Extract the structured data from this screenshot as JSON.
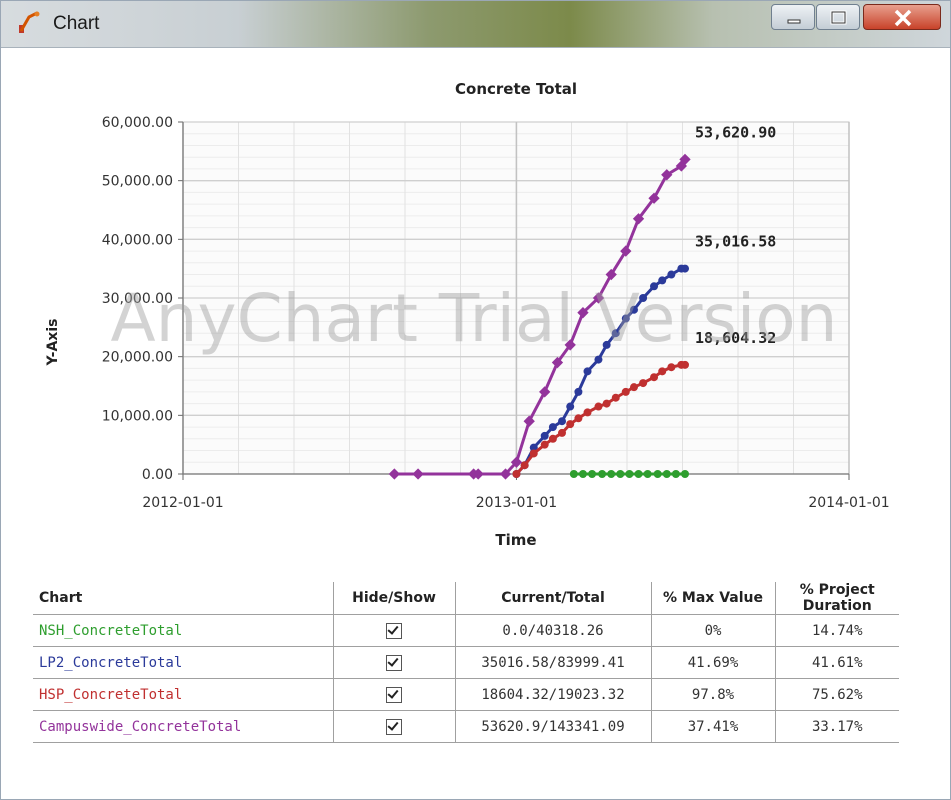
{
  "window": {
    "title": "Chart",
    "min_icon": "minimize-icon",
    "max_icon": "maximize-icon",
    "close_icon": "close-icon"
  },
  "watermark": "AnyChart Trial Version",
  "chart_data": {
    "type": "line",
    "title": "Concrete Total",
    "xlabel": "Time",
    "ylabel": "Y-Axis",
    "xlim": [
      "2012-01-01",
      "2014-01-01"
    ],
    "ylim": [
      0,
      60000
    ],
    "x_ticks": [
      "2012-01-01",
      "2013-01-01",
      "2014-01-01"
    ],
    "y_ticks": [
      "0.00",
      "10,000.00",
      "20,000.00",
      "30,000.00",
      "40,000.00",
      "50,000.00",
      "60,000.00"
    ],
    "grid": true,
    "series": [
      {
        "name": "NSH_ConcreteTotal",
        "color": "#2e9e2e",
        "x": [
          "2013-03-05",
          "2013-03-15",
          "2013-03-25",
          "2013-04-05",
          "2013-04-15",
          "2013-04-25",
          "2013-05-05",
          "2013-05-15",
          "2013-05-25",
          "2013-06-05",
          "2013-06-15",
          "2013-06-25",
          "2013-07-05"
        ],
        "y": [
          0,
          0,
          0,
          0,
          0,
          0,
          0,
          0,
          0,
          0,
          0,
          0,
          0
        ]
      },
      {
        "name": "LP2_ConcreteTotal",
        "color": "#2b3a9a",
        "x": [
          "2013-01-01",
          "2013-01-10",
          "2013-01-20",
          "2013-02-01",
          "2013-02-10",
          "2013-02-20",
          "2013-03-01",
          "2013-03-10",
          "2013-03-20",
          "2013-04-01",
          "2013-04-10",
          "2013-04-20",
          "2013-05-01",
          "2013-05-10",
          "2013-05-20",
          "2013-06-01",
          "2013-06-10",
          "2013-06-20",
          "2013-07-01",
          "2013-07-05"
        ],
        "y": [
          0,
          1500,
          4500,
          6500,
          8000,
          9000,
          11500,
          14000,
          17500,
          19500,
          22000,
          24000,
          26500,
          28000,
          30000,
          32000,
          33000,
          34000,
          35016.58,
          35016.58
        ]
      },
      {
        "name": "HSP_ConcreteTotal",
        "color": "#c03030",
        "x": [
          "2013-01-01",
          "2013-01-10",
          "2013-01-20",
          "2013-02-01",
          "2013-02-10",
          "2013-02-20",
          "2013-03-01",
          "2013-03-10",
          "2013-03-20",
          "2013-04-01",
          "2013-04-10",
          "2013-04-20",
          "2013-05-01",
          "2013-05-10",
          "2013-05-20",
          "2013-06-01",
          "2013-06-10",
          "2013-06-20",
          "2013-07-01",
          "2013-07-05"
        ],
        "y": [
          0,
          1500,
          3500,
          5000,
          6000,
          7000,
          8500,
          9500,
          10500,
          11500,
          12000,
          13000,
          14000,
          14800,
          15500,
          16500,
          17500,
          18200,
          18604.32,
          18604.32
        ]
      },
      {
        "name": "Campuswide_ConcreteTotal",
        "color": "#93339b",
        "x": [
          "2012-08-20",
          "2012-09-15",
          "2012-11-15",
          "2012-11-20",
          "2012-12-20",
          "2013-01-01",
          "2013-01-15",
          "2013-02-01",
          "2013-02-15",
          "2013-03-01",
          "2013-03-15",
          "2013-04-01",
          "2013-04-15",
          "2013-05-01",
          "2013-05-15",
          "2013-06-01",
          "2013-06-15",
          "2013-07-01",
          "2013-07-05"
        ],
        "y": [
          0,
          0,
          0,
          0,
          0,
          2000,
          9000,
          14000,
          19000,
          22000,
          27500,
          30000,
          34000,
          38000,
          43500,
          47000,
          51000,
          52500,
          53620.9
        ]
      }
    ],
    "end_labels": [
      "53,620.90",
      "35,016.58",
      "18,604.32"
    ]
  },
  "table": {
    "headers": [
      "Chart",
      "Hide/Show",
      "Current/Total",
      "% Max Value",
      "% Project Duration"
    ],
    "rows": [
      {
        "name": "NSH_ConcreteTotal",
        "color": "#2e9e2e",
        "checked": true,
        "current_total": "0.0/40318.26",
        "max_value": "0%",
        "duration": "14.74%"
      },
      {
        "name": "LP2_ConcreteTotal",
        "color": "#2b3a9a",
        "checked": true,
        "current_total": "35016.58/83999.41",
        "max_value": "41.69%",
        "duration": "41.61%"
      },
      {
        "name": "HSP_ConcreteTotal",
        "color": "#c03030",
        "checked": true,
        "current_total": "18604.32/19023.32",
        "max_value": "97.8%",
        "duration": "75.62%"
      },
      {
        "name": "Campuswide_ConcreteTotal",
        "color": "#93339b",
        "checked": true,
        "current_total": "53620.9/143341.09",
        "max_value": "37.41%",
        "duration": "33.17%"
      }
    ]
  }
}
